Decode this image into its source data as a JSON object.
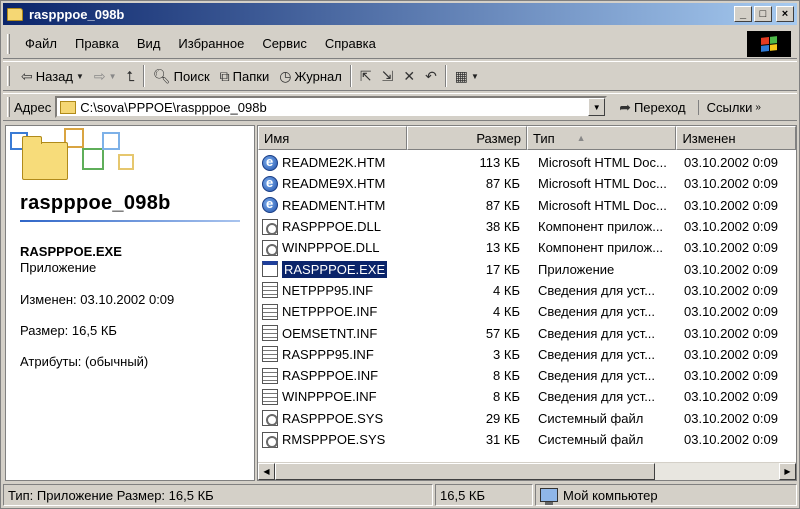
{
  "window": {
    "title": "raspppoe_098b"
  },
  "menu": [
    "Файл",
    "Правка",
    "Вид",
    "Избранное",
    "Сервис",
    "Справка"
  ],
  "toolbar": {
    "back": "Назад",
    "search": "Поиск",
    "folders": "Папки",
    "history": "Журнал"
  },
  "address": {
    "label": "Адрес",
    "value": "C:\\sova\\PPPOE\\raspppoe_098b",
    "go": "Переход",
    "links": "Ссылки"
  },
  "left_pane": {
    "folder_title": "raspppoe_098b",
    "selected_name": "RASPPPOE.EXE",
    "selected_type": "Приложение",
    "modified": "Изменен: 03.10.2002 0:09",
    "size": "Размер: 16,5 КБ",
    "attributes": "Атрибуты: (обычный)"
  },
  "columns": {
    "name": "Имя",
    "size": "Размер",
    "type": "Тип",
    "type_sort": "▲",
    "modified": "Изменен"
  },
  "files": [
    {
      "name": "README2K.HTM",
      "size": "113 КБ",
      "type": "Microsoft HTML Doc...",
      "date": "03.10.2002 0:09",
      "icon": "htm"
    },
    {
      "name": "README9X.HTM",
      "size": "87 КБ",
      "type": "Microsoft HTML Doc...",
      "date": "03.10.2002 0:09",
      "icon": "htm"
    },
    {
      "name": "READMENT.HTM",
      "size": "87 КБ",
      "type": "Microsoft HTML Doc...",
      "date": "03.10.2002 0:09",
      "icon": "htm"
    },
    {
      "name": "RASPPPOE.DLL",
      "size": "38 КБ",
      "type": "Компонент прилож...",
      "date": "03.10.2002 0:09",
      "icon": "doc"
    },
    {
      "name": "WINPPPOE.DLL",
      "size": "13 КБ",
      "type": "Компонент прилож...",
      "date": "03.10.2002 0:09",
      "icon": "doc"
    },
    {
      "name": "RASPPPOE.EXE",
      "size": "17 КБ",
      "type": "Приложение",
      "date": "03.10.2002 0:09",
      "icon": "exe",
      "selected": true
    },
    {
      "name": "NETPPP95.INF",
      "size": "4 КБ",
      "type": "Сведения для уст...",
      "date": "03.10.2002 0:09",
      "icon": "inf"
    },
    {
      "name": "NETPPPOE.INF",
      "size": "4 КБ",
      "type": "Сведения для уст...",
      "date": "03.10.2002 0:09",
      "icon": "inf"
    },
    {
      "name": "OEMSETNT.INF",
      "size": "57 КБ",
      "type": "Сведения для уст...",
      "date": "03.10.2002 0:09",
      "icon": "inf"
    },
    {
      "name": "RASPPP95.INF",
      "size": "3 КБ",
      "type": "Сведения для уст...",
      "date": "03.10.2002 0:09",
      "icon": "inf"
    },
    {
      "name": "RASPPPOE.INF",
      "size": "8 КБ",
      "type": "Сведения для уст...",
      "date": "03.10.2002 0:09",
      "icon": "inf"
    },
    {
      "name": "WINPPPOE.INF",
      "size": "8 КБ",
      "type": "Сведения для уст...",
      "date": "03.10.2002 0:09",
      "icon": "inf"
    },
    {
      "name": "RASPPPOE.SYS",
      "size": "29 КБ",
      "type": "Системный файл",
      "date": "03.10.2002 0:09",
      "icon": "doc"
    },
    {
      "name": "RMSPPPOE.SYS",
      "size": "31 КБ",
      "type": "Системный файл",
      "date": "03.10.2002 0:09",
      "icon": "doc"
    }
  ],
  "status": {
    "info": "Тип: Приложение Размер: 16,5 КБ",
    "size": "16,5 КБ",
    "location": "Мой компьютер"
  },
  "colors": {
    "title_start": "#0a246a",
    "title_end": "#a6caf0",
    "selection": "#0a246a",
    "face": "#d4d0c8"
  }
}
